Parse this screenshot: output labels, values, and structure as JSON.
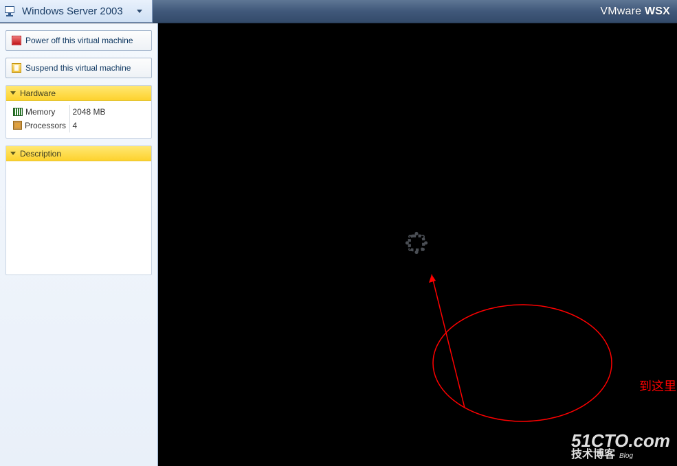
{
  "header": {
    "vm_name": "Windows Server 2003",
    "brand_prefix": "VMware",
    "brand_suffix": "WSX"
  },
  "sidebar": {
    "power_off_label": "Power off this virtual machine",
    "suspend_label": "Suspend this virtual machine",
    "hardware_header": "Hardware",
    "hardware": {
      "memory_label": "Memory",
      "memory_value": "2048 MB",
      "processors_label": "Processors",
      "processors_value": "4"
    },
    "description_header": "Description",
    "description_value": ""
  },
  "annotation": {
    "text": "到这里就一直停留",
    "color": "#ff0000"
  },
  "watermark": {
    "main": "51CTO.com",
    "sub": "技术博客",
    "blog": "Blog"
  }
}
